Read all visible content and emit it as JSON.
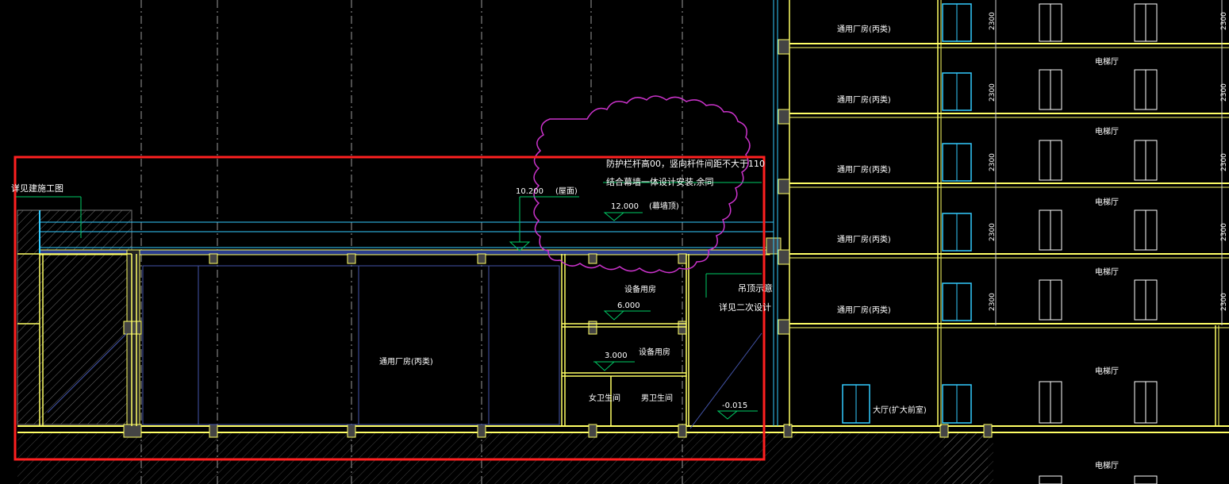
{
  "drawing": {
    "colors": {
      "background": "#000000",
      "wall": "#ffff66",
      "glass": "#33ccff",
      "axis": "#aaaaaa",
      "level_marker": "#00cc66",
      "revision_cloud": "#cc33cc",
      "highlight_box": "#ff2020",
      "text": "#ffffff"
    },
    "notes": {
      "detail_ref": "详见建施工图",
      "guardrail_line1": "防护栏杆高00，竖向杆件间距不大于110",
      "guardrail_line2": "结合幕墙一体设计安装,余同",
      "ceiling_line1": "吊顶示意",
      "ceiling_line2": "详见二次设计"
    },
    "levels": {
      "roof": "10.200",
      "roof_note": "(屋面)",
      "curtain_wall": "12.000",
      "curtain_wall_note": "(幕墙顶)",
      "level_6": "6.000",
      "level_3": "3.000",
      "ground": "-0.015"
    },
    "rooms": {
      "main_hall": "通用厂房(丙类)",
      "equipment_upper": "设备用房",
      "equipment_lower": "设备用房",
      "female_wc": "女卫生间",
      "male_wc": "男卫生间",
      "lobby": "大厅(扩大前室)"
    },
    "tower": {
      "floor_label": "通用厂房(丙类)",
      "elevator_label": "电梯厅",
      "dimension": "2300"
    }
  }
}
